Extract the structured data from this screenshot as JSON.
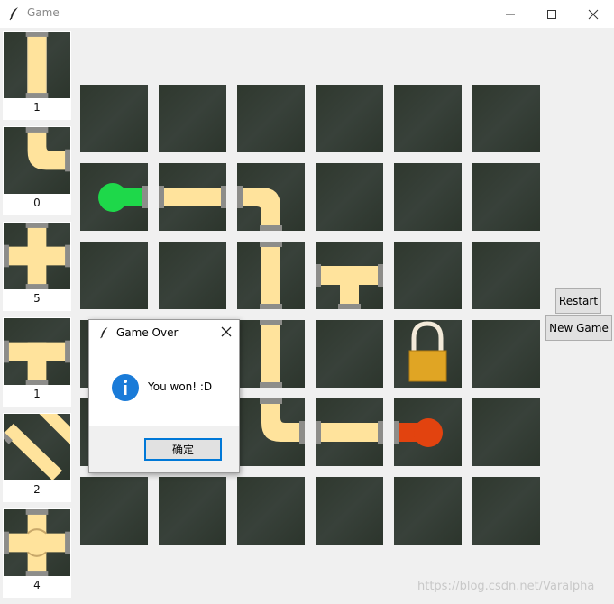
{
  "window": {
    "title": "Game",
    "controls": [
      "minimize-icon",
      "maximize-icon",
      "close-icon"
    ]
  },
  "palette": [
    {
      "piece": "straight",
      "count": "1"
    },
    {
      "piece": "elbow",
      "count": "0"
    },
    {
      "piece": "cross",
      "count": "5"
    },
    {
      "piece": "tee",
      "count": "1"
    },
    {
      "piece": "diagonal",
      "count": "2"
    },
    {
      "piece": "crossover",
      "count": "4"
    }
  ],
  "board": {
    "rows": 6,
    "cols": 6,
    "tiles": [
      [
        "empty",
        "empty",
        "empty",
        "empty",
        "empty",
        "empty"
      ],
      [
        "start",
        "straight",
        "elbow",
        "empty",
        "empty",
        "empty"
      ],
      [
        "empty",
        "empty",
        "straight-vertical",
        "tee",
        "empty",
        "empty"
      ],
      [
        "empty",
        "empty",
        "straight-vertical",
        "empty",
        "lock",
        "empty"
      ],
      [
        "empty",
        "empty",
        "elbow",
        "straight",
        "end",
        "empty"
      ],
      [
        "empty",
        "empty",
        "empty",
        "empty",
        "empty",
        "empty"
      ]
    ]
  },
  "buttons": {
    "restart": "Restart",
    "new_game": "New Game"
  },
  "dialog": {
    "title": "Game Over",
    "message": "You won! :D",
    "ok": "确定",
    "icon": "info-icon"
  },
  "watermark": "https://blog.csdn.net/Varalpha",
  "colors": {
    "tile_bg": "#313a30",
    "pipe": "#ffe39c",
    "start": "#1ed84a",
    "end": "#e2430f",
    "lock": "#e0a524"
  }
}
